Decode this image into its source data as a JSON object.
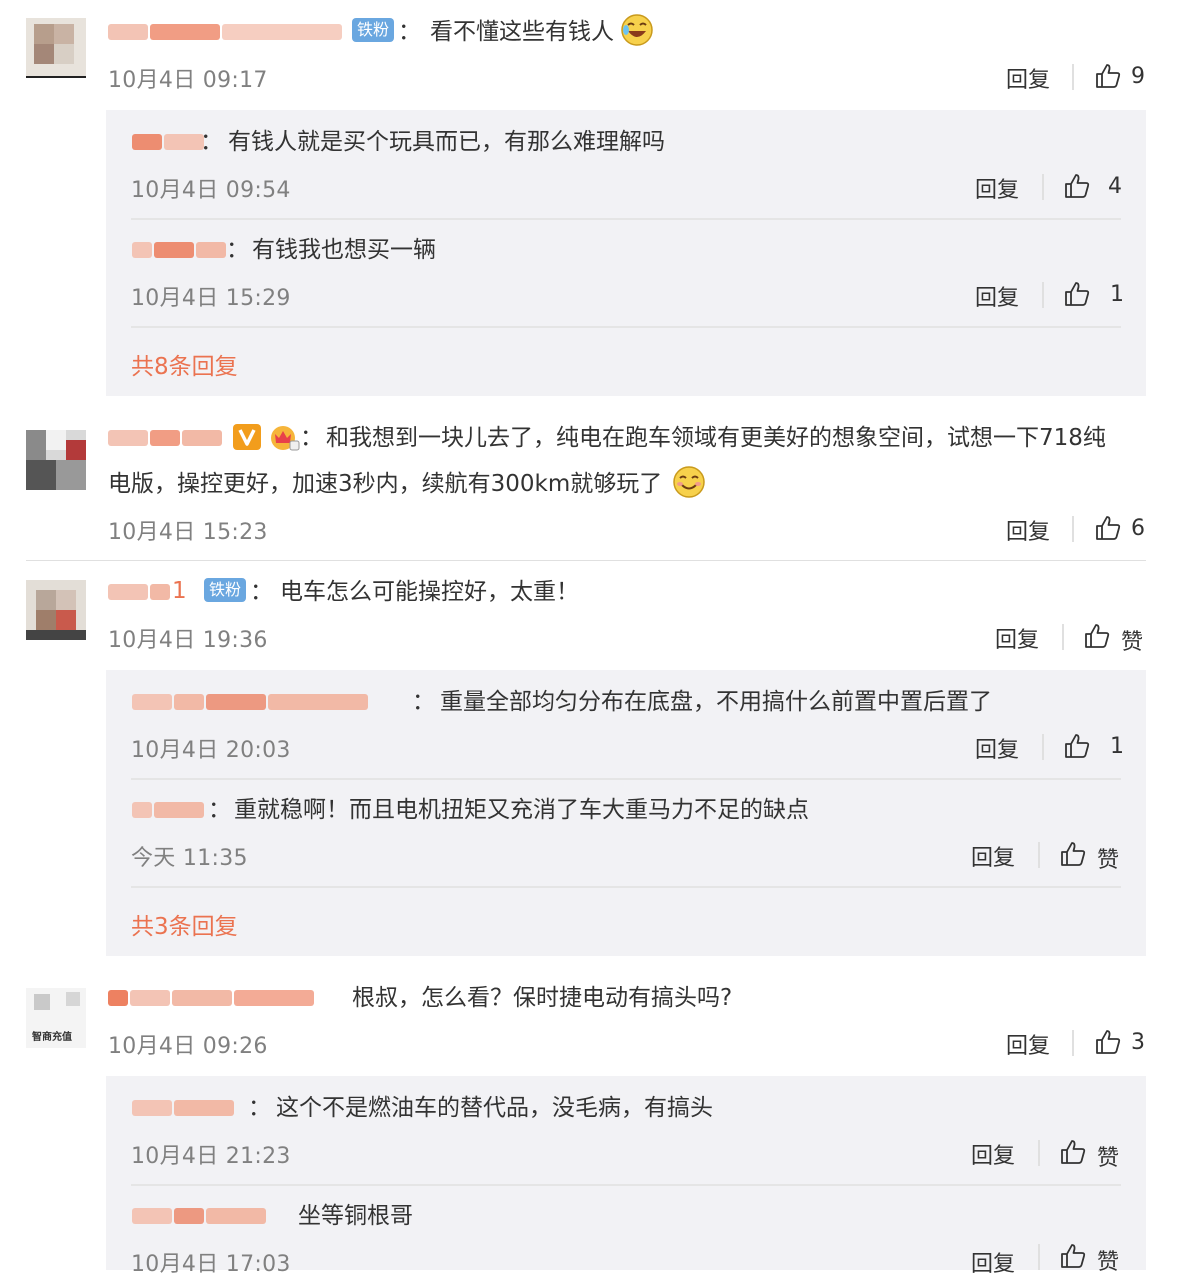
{
  "labels": {
    "reply": "回复",
    "like": "赞",
    "fan_badge": "铁粉",
    "colon": "："
  },
  "comments": [
    {
      "text": "看不懂这些有钱人",
      "time": "10月4日 09:17",
      "likes": "9",
      "replies": [
        {
          "text": "有钱人就是买个玩具而已，有那么难理解吗",
          "time": "10月4日 09:54",
          "likes": "4"
        },
        {
          "text": "有钱我也想买一辆",
          "time": "10月4日 15:29",
          "likes": "1"
        }
      ],
      "more": "共8条回复"
    },
    {
      "text_line1": "和我想到一块儿去了，纯电在跑车领域有更美好的想象空间，试想一下718纯",
      "text_line2": "电版，操控更好，加速3秒内，续航有300km就够玩了",
      "time": "10月4日 15:23",
      "likes": "6"
    },
    {
      "text": "电车怎么可能操控好，太重！",
      "time": "10月4日 19:36",
      "likes": "赞",
      "name_fragment": "1",
      "replies": [
        {
          "text": "重量全部均匀分布在底盘，不用搞什么前置中置后置了",
          "time": "10月4日 20:03",
          "likes": "1"
        },
        {
          "text": "重就稳啊！而且电机扭矩又充消了车大重马力不足的缺点",
          "time": "今天 11:35",
          "likes": "赞"
        }
      ],
      "more": "共3条回复"
    },
    {
      "text": "根叔，怎么看？保时捷电动有搞头吗?",
      "time": "10月4日 09:26",
      "likes": "3",
      "avatar_text": "智商充值",
      "replies": [
        {
          "text": "这个不是燃油车的替代品，没毛病，有搞头",
          "time": "10月4日 21:23",
          "likes": "赞"
        },
        {
          "text": "坐等铜根哥",
          "time": "10月4日 17:03",
          "likes": "赞"
        }
      ]
    }
  ],
  "colors": {
    "accent": "#eb7350",
    "fan_badge": "#6aa7e0",
    "reply_bg": "#f2f2f5",
    "time": "#808080"
  }
}
